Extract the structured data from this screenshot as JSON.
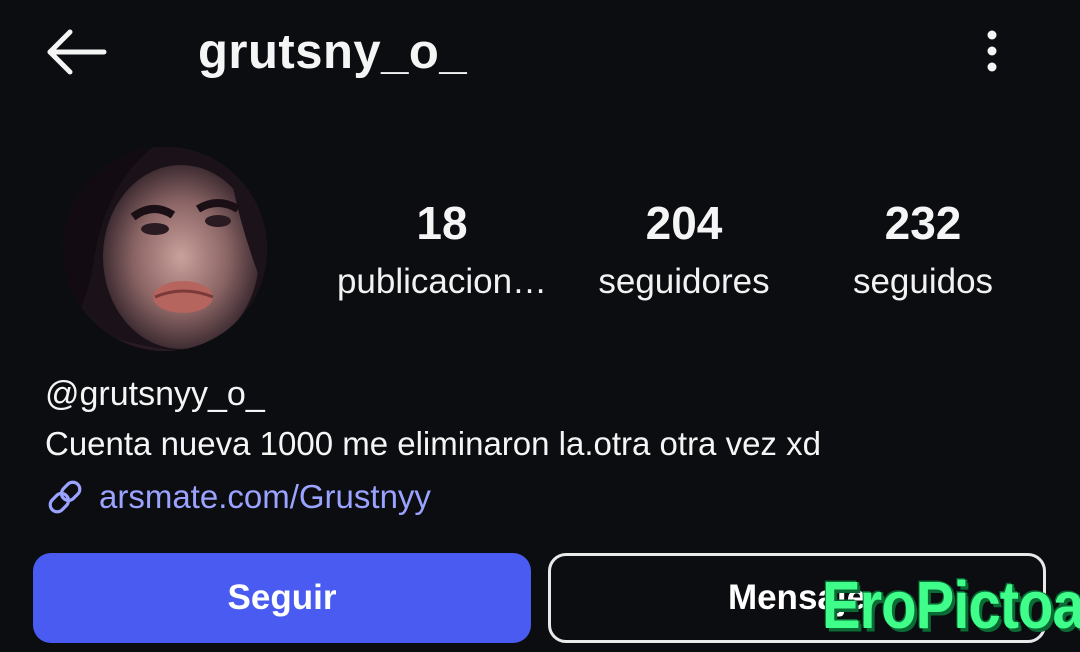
{
  "header": {
    "title": "grutsny_o_",
    "back_icon": "arrow-left-icon",
    "more_icon": "more-vertical-icon"
  },
  "profile": {
    "avatar": "profile-photo",
    "stats": {
      "posts": {
        "count": "18",
        "label": "publicacion…"
      },
      "followers": {
        "count": "204",
        "label": "seguidores"
      },
      "following": {
        "count": "232",
        "label": "seguidos"
      }
    },
    "handle": "@grutsnyy_o_",
    "bio": "Cuenta nueva 1000 me eliminaron la.otra otra vez xd",
    "link": {
      "icon": "link-icon",
      "text": "arsmate.com/Grustnyy"
    }
  },
  "actions": {
    "follow_label": "Seguir",
    "message_label": "Mensaje"
  },
  "watermark": "EroPictoa",
  "colors": {
    "background": "#0c0d11",
    "follow_button": "#4a5bf1",
    "link": "#9aa3ff",
    "watermark": "#3fff8a"
  }
}
